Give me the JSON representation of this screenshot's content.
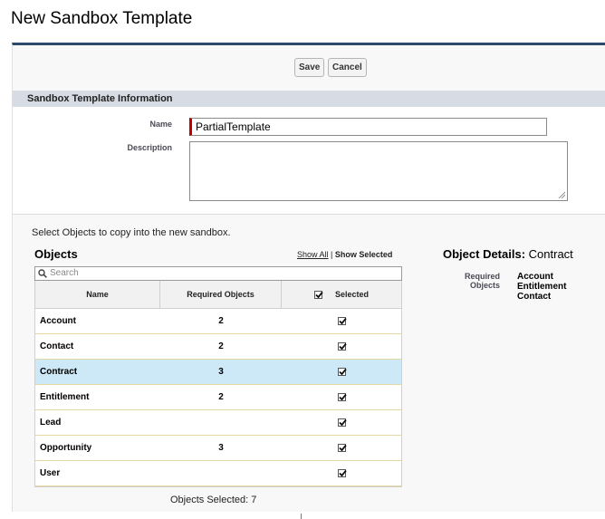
{
  "page": {
    "title": "New Sandbox Template"
  },
  "toolbar": {
    "save_label": "Save",
    "cancel_label": "Cancel"
  },
  "section": {
    "title": "Sandbox Template Information"
  },
  "form": {
    "name_label": "Name",
    "name_value": "PartialTemplate",
    "description_label": "Description",
    "description_value": ""
  },
  "objects": {
    "intro": "Select Objects to copy into the new sandbox.",
    "heading": "Objects",
    "show_all": "Show All",
    "separator": "|",
    "show_selected": "Show Selected",
    "search_placeholder": "Search",
    "columns": {
      "name": "Name",
      "required": "Required Objects",
      "selected": "Selected"
    },
    "rows": [
      {
        "name": "Account",
        "required": "2",
        "selected": true
      },
      {
        "name": "Contact",
        "required": "2",
        "selected": true
      },
      {
        "name": "Contract",
        "required": "3",
        "selected": true,
        "highlighted": true
      },
      {
        "name": "Entitlement",
        "required": "2",
        "selected": true
      },
      {
        "name": "Lead",
        "required": "",
        "selected": true
      },
      {
        "name": "Opportunity",
        "required": "3",
        "selected": true
      },
      {
        "name": "User",
        "required": "",
        "selected": true
      }
    ],
    "selected_count_label": "Objects Selected:",
    "selected_count": "7"
  },
  "details": {
    "heading": "Object Details:",
    "object_name": "Contract",
    "required_label_1": "Required",
    "required_label_2": "Objects",
    "required_objects": [
      "Account",
      "Entitlement",
      "Contact"
    ]
  },
  "colors": {
    "header_bar": "#2a4a6b",
    "section_bg": "#d7dbe4",
    "highlight_row": "#cde8f6",
    "required_marker": "#c00000"
  },
  "icons": {
    "search": "search-icon",
    "checkbox": "checkbox-checked-icon",
    "resize": "resize-grip-icon"
  }
}
